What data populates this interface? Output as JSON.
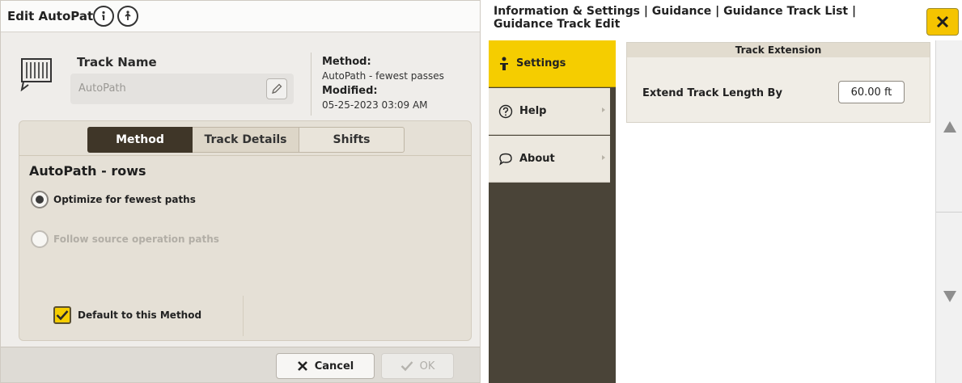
{
  "left_panel": {
    "title": "Edit AutoPath",
    "track_name_label": "Track Name",
    "track_name_value": "AutoPath",
    "method_label": "Method:",
    "method_value": "AutoPath - fewest passes",
    "modified_label": "Modified:",
    "modified_value": "05-25-2023 03:09 AM",
    "tabs": [
      {
        "label": "Method",
        "active": true
      },
      {
        "label": "Track Details",
        "active": false
      },
      {
        "label": "Shifts",
        "active": false
      }
    ],
    "method_heading": "AutoPath - rows",
    "options": [
      {
        "label": "Optimize for fewest paths",
        "selected": true,
        "enabled": true
      },
      {
        "label": "Follow source operation paths",
        "selected": false,
        "enabled": false
      }
    ],
    "default_checkbox": {
      "label": "Default to this Method",
      "checked": true
    },
    "footer": {
      "cancel_label": "Cancel",
      "ok_label": "OK",
      "ok_enabled": false
    }
  },
  "right_panel": {
    "title": "Information & Settings | Guidance | Guidance Track List | Guidance Track Edit",
    "sidebar": [
      {
        "label": "Settings",
        "icon": "person-standing-icon",
        "active": true
      },
      {
        "label": "Help",
        "icon": "question-circle-icon",
        "active": false
      },
      {
        "label": "About",
        "icon": "speech-bubble-icon",
        "active": false
      }
    ],
    "section_header": "Track Extension",
    "extend_label": "Extend Track Length By",
    "extend_value": "60.00 ft"
  },
  "colors": {
    "accent_yellow": "#f5cd00",
    "dark_tab": "#3f3628",
    "sidebar_dark": "#4a4438"
  }
}
